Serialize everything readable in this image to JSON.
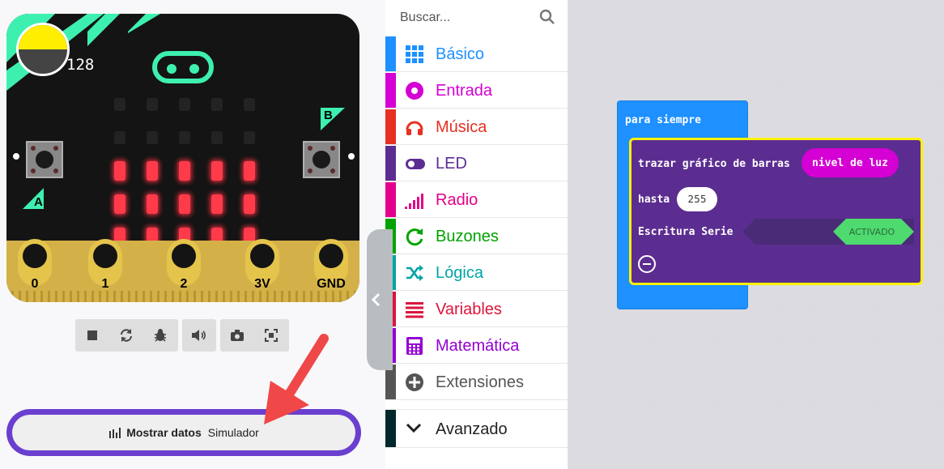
{
  "simulator": {
    "light_level": "128",
    "light_fraction": 0.5,
    "led_rows_on": [
      false,
      false,
      true,
      true,
      true
    ],
    "button_a_label": "A",
    "button_b_label": "B",
    "pins": [
      "0",
      "1",
      "2",
      "3V",
      "GND"
    ],
    "toolbar": [
      "stop-icon",
      "restart-icon",
      "debug-icon",
      "sound-icon",
      "screenshot-icon",
      "fullscreen-icon"
    ],
    "show_data": {
      "bold": "Mostrar datos",
      "rest": "Simulador"
    }
  },
  "toolbox": {
    "search_placeholder": "Buscar...",
    "categories": [
      {
        "label": "Básico",
        "color": "#1e90ff",
        "icon": "grid-icon"
      },
      {
        "label": "Entrada",
        "color": "#d400d4",
        "icon": "circle-target-icon"
      },
      {
        "label": "Música",
        "color": "#e63022",
        "icon": "headphones-icon"
      },
      {
        "label": "LED",
        "color": "#5c2d91",
        "icon": "toggle-icon"
      },
      {
        "label": "Radio",
        "color": "#e3008c",
        "icon": "signal-bars-icon"
      },
      {
        "label": "Buzones",
        "color": "#00a300",
        "icon": "refresh-icon"
      },
      {
        "label": "Lógica",
        "color": "#00a4a6",
        "icon": "shuffle-icon"
      },
      {
        "label": "Variables",
        "color": "#dc143c",
        "icon": "list-icon"
      },
      {
        "label": "Matemática",
        "color": "#9400d3",
        "icon": "calculator-icon"
      },
      {
        "label": "Extensiones",
        "color": "#555555",
        "icon": "plus-circle-icon"
      }
    ],
    "advanced": {
      "label": "Avanzado",
      "color": "#00272b",
      "icon": "chevron-down-icon"
    }
  },
  "workspace": {
    "forever_label": "para siempre",
    "plot_label": "trazar gráfico de barras",
    "plot_value": "nivel de luz",
    "up_to_label": "hasta",
    "up_to_value": "255",
    "serial_label": "Escritura Serie",
    "serial_toggle": "ACTIVADO"
  }
}
